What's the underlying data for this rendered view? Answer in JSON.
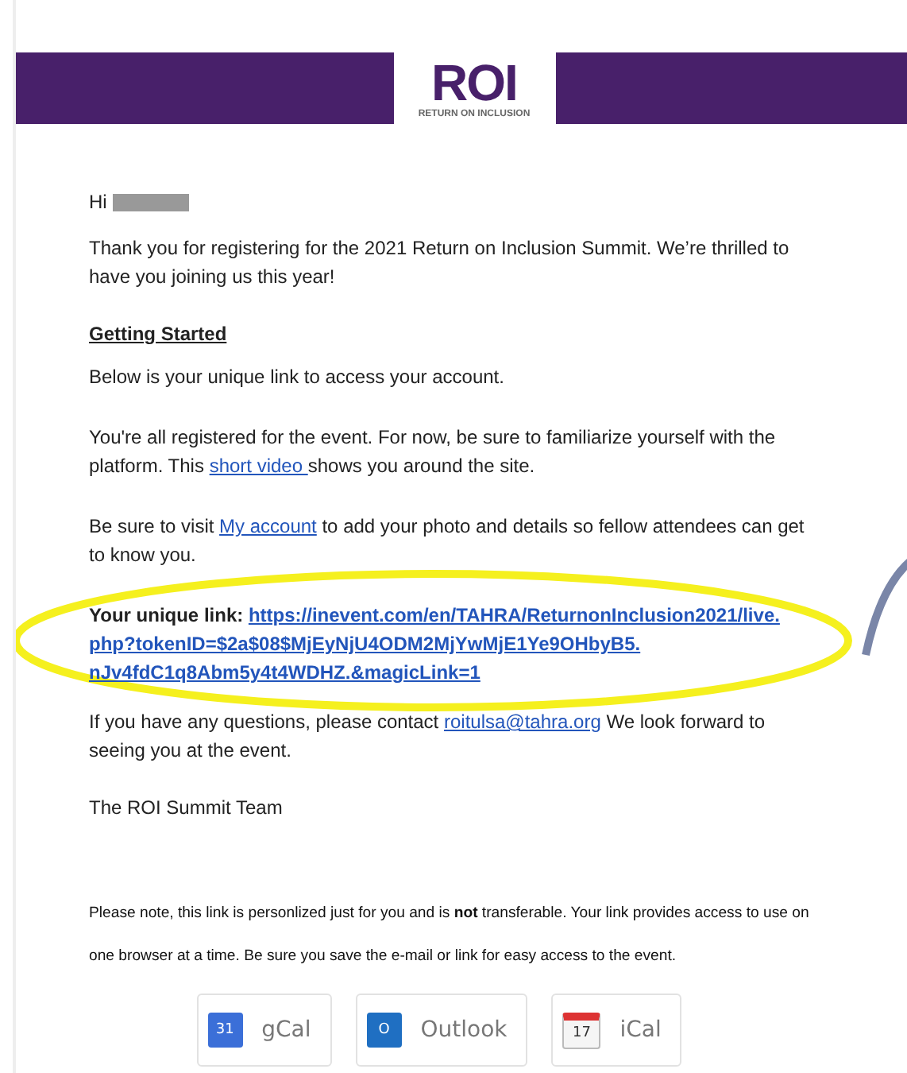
{
  "banner": {
    "logo_letters": "ROI",
    "logo_tagline": "RETURN ON INCLUSION"
  },
  "greeting": {
    "text": "Hi",
    "name_redacted": true
  },
  "intro": "Thank you for registering for the 2021 Return on Inclusion Summit. We’re thrilled to have you joining us this year!",
  "heading": "Getting Started",
  "paragraphs": [
    {
      "segments": [
        {
          "kind": "text",
          "text": "Below is your unique link to access your account."
        }
      ]
    },
    {
      "segments": [
        {
          "kind": "text",
          "text": "You're all registered for the event. For now, be sure to familiarize yourself with the platform. This "
        },
        {
          "kind": "link",
          "text": "short video "
        },
        {
          "kind": "text",
          "text": "shows you around the site."
        }
      ]
    },
    {
      "segments": [
        {
          "kind": "text",
          "text": "Be sure to visit "
        },
        {
          "kind": "link",
          "text": "My account"
        },
        {
          "kind": "text",
          "text": " to add your photo and details so fellow attendees can get to know you."
        }
      ]
    }
  ],
  "unique_link": {
    "label": "Your unique link:",
    "url_lines": [
      "https://inevent.com/en/TAHRA/ReturnonInclusion2021/live.",
      "php?tokenID=$2a$08$MjEyNjU4ODM2MjYwMjE1Ye9OHbyB5.",
      "nJv4fdC1q8Abm5y4t4WDHZ.&magicLink=1"
    ],
    "highlighted": true
  },
  "contact": {
    "segments": [
      {
        "kind": "text",
        "text": "If you have any questions, please contact "
      },
      {
        "kind": "link",
        "text": "roitulsa@tahra.org"
      },
      {
        "kind": "text",
        "text": "  We look forward to seeing you at the event."
      }
    ]
  },
  "signature": "The ROI Summit Team",
  "note": "Please note, this link is personlized just for you and is **not** transferable. Your link provides access to use on one browser at a time. Be sure you save the e-mail or link for easy access to the event.",
  "calendar_buttons": [
    {
      "kind": "gcal",
      "label": "gCal",
      "icon_text": "31"
    },
    {
      "kind": "outlook",
      "label": "Outlook",
      "icon_text": "O"
    },
    {
      "kind": "ical",
      "label": "iCal",
      "icon_text": "17"
    }
  ]
}
